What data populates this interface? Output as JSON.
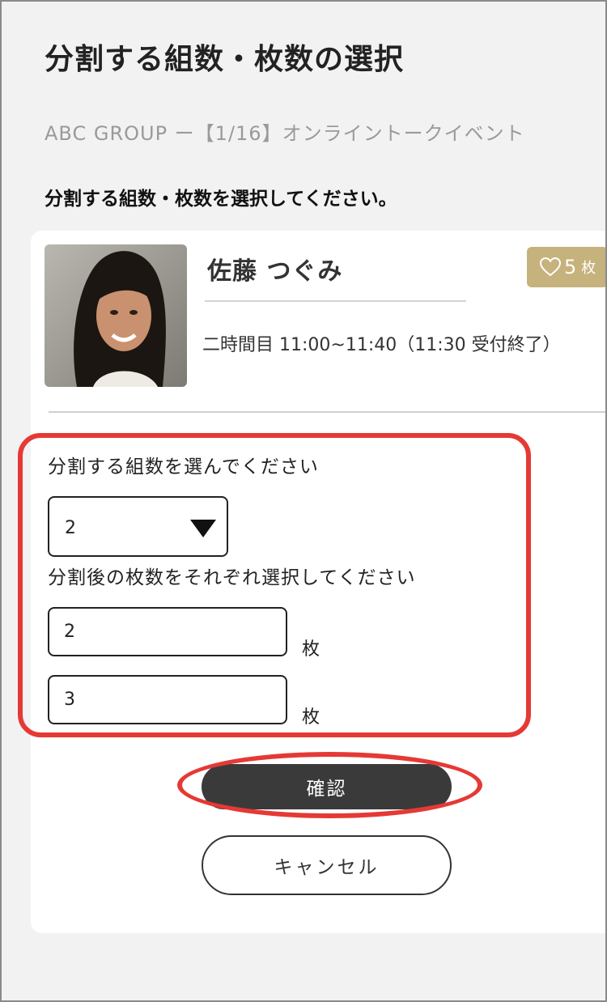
{
  "header": {
    "title": "分割する組数・枚数の選択",
    "subtitle": "ABC GROUP ー【1/16】オンライントークイベント",
    "instruction": "分割する組数・枚数を選択してください。"
  },
  "ticket": {
    "member_name": "佐藤 つぐみ",
    "timeslot": "二時間目 11:00~11:40（11:30 受付終了）",
    "badge_count": "5",
    "badge_unit": "枚",
    "badge_icon": "heart-outline-icon",
    "badge_color": "#c6b27c"
  },
  "form": {
    "group_label": "分割する組数を選んでください",
    "group_value": "2",
    "qty_label": "分割後の枚数をそれぞれ選択してください",
    "quantities": [
      {
        "value": "2",
        "unit": "枚"
      },
      {
        "value": "3",
        "unit": "枚"
      }
    ]
  },
  "actions": {
    "confirm_label": "確認",
    "cancel_label": "キャンセル"
  },
  "colors": {
    "highlight": "#e53935",
    "confirm_bg": "#3a3a3a",
    "page_bg": "#f2f2f2"
  }
}
